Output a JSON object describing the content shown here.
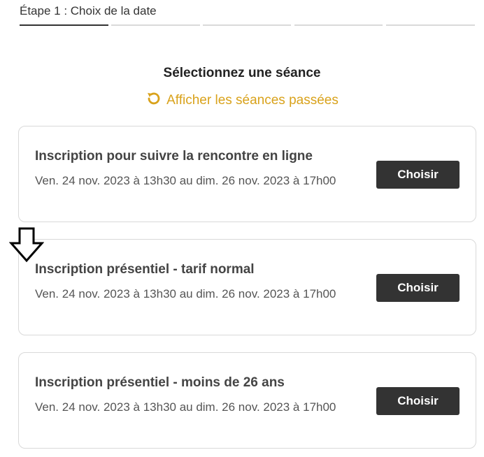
{
  "stepper": {
    "current_step_label": "Étape 1 : Choix de la date",
    "step_count": 5,
    "active_index": 0
  },
  "session_section": {
    "title": "Sélectionnez une séance",
    "past_sessions_link": "Afficher les séances passées",
    "past_sessions_icon": "undo-icon",
    "accent_color": "#d9a21b"
  },
  "sessions": [
    {
      "title": "Inscription pour suivre la rencontre en ligne",
      "date": "Ven. 24 nov. 2023 à 13h30 au dim. 26 nov. 2023 à 17h00",
      "button_label": "Choisir"
    },
    {
      "title": "Inscription présentiel - tarif normal",
      "date": "Ven. 24 nov. 2023 à 13h30 au dim. 26 nov. 2023 à 17h00",
      "button_label": "Choisir"
    },
    {
      "title": "Inscription présentiel - moins de 26 ans",
      "date": "Ven. 24 nov. 2023 à 13h30 au dim. 26 nov. 2023 à 17h00",
      "button_label": "Choisir"
    }
  ],
  "overlay": {
    "pointer_icon": "down-arrow-icon"
  },
  "colors": {
    "button_bg": "#333333",
    "button_text": "#ffffff",
    "card_border": "#d9d9d9"
  }
}
